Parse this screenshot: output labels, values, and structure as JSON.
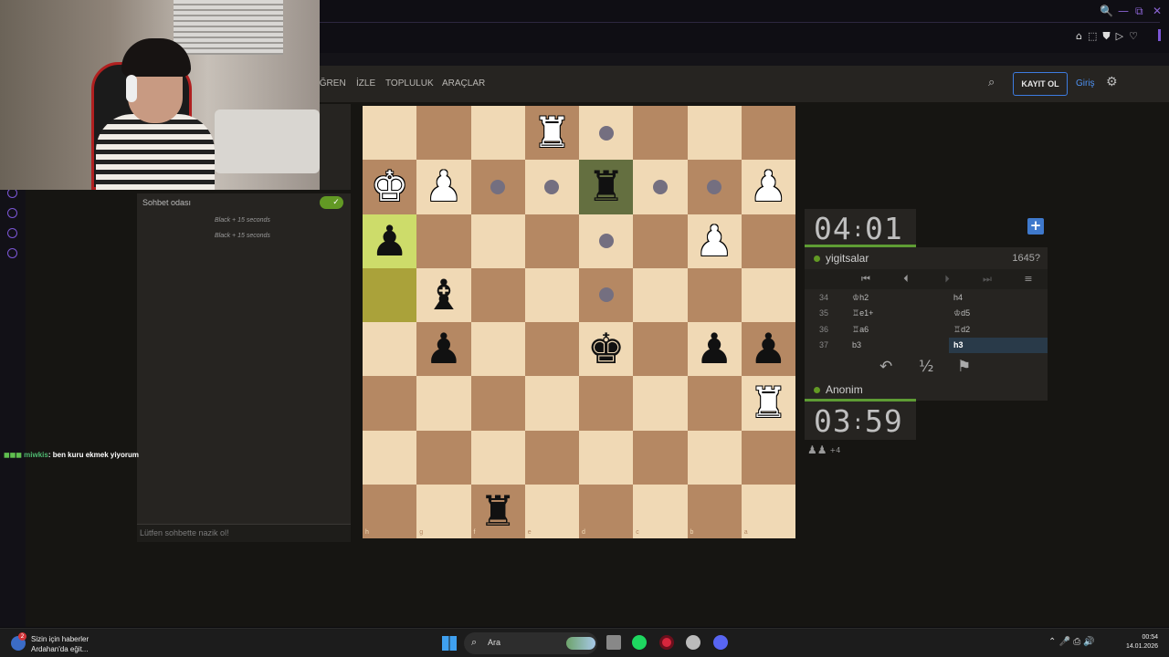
{
  "window": {
    "controls": [
      "🔍",
      "—",
      "⧉",
      "✕"
    ]
  },
  "extensions": [
    "⌂",
    "⬚",
    "⛊",
    "▷",
    "♡"
  ],
  "nav": {
    "links": [
      "ÖĞREN",
      "İZLE",
      "TOPLULUK",
      "ARAÇLAR"
    ],
    "signup_label": "KAYIT OL",
    "login_label": "Giriş"
  },
  "chat": {
    "title": "Sohbet odası",
    "lines": [
      "Black + 15 seconds",
      "Black + 15 seconds"
    ],
    "placeholder": "Lütfen sohbette nazik ol!"
  },
  "stream_chat": {
    "user": "miwkis",
    "text": ": ben kuru ekmek yiyorum"
  },
  "board": {
    "files": [
      "h",
      "g",
      "f",
      "e",
      "d",
      "c",
      "b",
      "a"
    ],
    "ranks": [
      "1",
      "2",
      "3",
      "4",
      "5",
      "6",
      "7",
      "8"
    ],
    "pieces": [
      {
        "sq": "e1",
        "glyph": "♜",
        "color": "white"
      },
      {
        "sq": "h2",
        "glyph": "♚",
        "color": "white"
      },
      {
        "sq": "g2",
        "glyph": "♟",
        "color": "white"
      },
      {
        "sq": "d2",
        "glyph": "♜",
        "color": "black"
      },
      {
        "sq": "a2",
        "glyph": "♟",
        "color": "white"
      },
      {
        "sq": "h3",
        "glyph": "♟",
        "color": "black"
      },
      {
        "sq": "b3",
        "glyph": "♟",
        "color": "white"
      },
      {
        "sq": "g4",
        "glyph": "♝",
        "color": "black"
      },
      {
        "sq": "g5",
        "glyph": "♟",
        "color": "black"
      },
      {
        "sq": "d5",
        "glyph": "♚",
        "color": "black"
      },
      {
        "sq": "b5",
        "glyph": "♟",
        "color": "black"
      },
      {
        "sq": "a5",
        "glyph": "♟",
        "color": "black"
      },
      {
        "sq": "a6",
        "glyph": "♜",
        "color": "white"
      },
      {
        "sq": "f8",
        "glyph": "♜",
        "color": "black"
      }
    ],
    "last_move": [
      "h3",
      "h4"
    ],
    "selected": "d2",
    "move_dots": [
      "d1",
      "f2",
      "e2",
      "c2",
      "b2",
      "d3",
      "d4"
    ]
  },
  "clocks": {
    "top": {
      "min": "04",
      "sep": ":",
      "sec": "01"
    },
    "bottom": {
      "min": "03",
      "sep": ":",
      "sec": "59"
    }
  },
  "players": {
    "top": {
      "name": "yigitsalar",
      "rating": "1645?"
    },
    "bottom": {
      "name": "Anonim"
    }
  },
  "moves": [
    {
      "n": "34",
      "w": "♔h2",
      "b": "h4"
    },
    {
      "n": "35",
      "w": "♖e1+",
      "b": "♔d5"
    },
    {
      "n": "36",
      "w": "♖a6",
      "b": "♖d2"
    },
    {
      "n": "37",
      "w": "b3",
      "b": "h3"
    }
  ],
  "nav_buttons": [
    "⏮",
    "⏴",
    "⏵",
    "⏭",
    "≡"
  ],
  "actions": {
    "takeback": "↶",
    "draw": "½",
    "resign": "⚑"
  },
  "captured": {
    "pieces": "♟♟",
    "plus": "+4"
  },
  "taskbar": {
    "news_title": "Sizin için haberler",
    "news_sub": "Ardahan'da eğit...",
    "news_badge": "2",
    "search_label": "Ara",
    "time": "00:54",
    "date": "14.01.2026",
    "tray": "⌃ 🎤 ⎙ 🔊"
  }
}
